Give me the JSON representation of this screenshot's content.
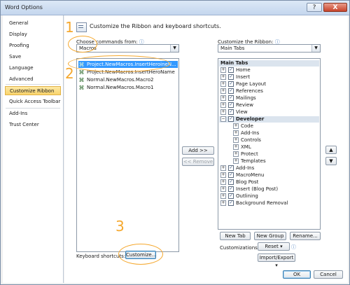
{
  "window": {
    "title": "Word Options",
    "help": "?",
    "close": "X"
  },
  "nav": [
    "General",
    "Display",
    "Proofing",
    "Save",
    "Language",
    "Advanced",
    "Customize Ribbon",
    "Quick Access Toolbar",
    "Add-Ins",
    "Trust Center"
  ],
  "header": "Customize the Ribbon and keyboard shortcuts.",
  "left": {
    "choose_label": "Choose commands from:",
    "choose_value": "Macros",
    "items": [
      "Project.NewMacros.InsertHeroineN...",
      "Project.NewMacros.InsertHeroName",
      "Normal.NewMacros.Macro2",
      "Normal.NewMacros.Macro1"
    ]
  },
  "right": {
    "customize_label": "Customize the Ribbon:",
    "customize_value": "Main Tabs",
    "tree": [
      {
        "label": "Main Tabs",
        "type": "header"
      },
      {
        "label": "Home",
        "type": "tab"
      },
      {
        "label": "Insert",
        "type": "tab"
      },
      {
        "label": "Page Layout",
        "type": "tab"
      },
      {
        "label": "References",
        "type": "tab"
      },
      {
        "label": "Mailings",
        "type": "tab"
      },
      {
        "label": "Review",
        "type": "tab"
      },
      {
        "label": "View",
        "type": "tab"
      },
      {
        "label": "Developer",
        "type": "tab-open"
      },
      {
        "label": "Code",
        "type": "group"
      },
      {
        "label": "Add-Ins",
        "type": "group"
      },
      {
        "label": "Controls",
        "type": "group"
      },
      {
        "label": "XML",
        "type": "group"
      },
      {
        "label": "Protect",
        "type": "group"
      },
      {
        "label": "Templates",
        "type": "group"
      },
      {
        "label": "Add-Ins",
        "type": "tab"
      },
      {
        "label": "MacroMenu",
        "type": "tab"
      },
      {
        "label": "Blog Post",
        "type": "tab"
      },
      {
        "label": "Insert (Blog Post)",
        "type": "tab"
      },
      {
        "label": "Outlining",
        "type": "tab"
      },
      {
        "label": "Background Removal",
        "type": "tab"
      }
    ]
  },
  "buttons": {
    "add": "Add >>",
    "remove": "<< Remove",
    "new_tab": "New Tab",
    "new_group": "New Group",
    "rename": "Rename...",
    "customizations_label": "Customizations:",
    "reset": "Reset ▾",
    "import_export": "Import/Export ▾",
    "keyboard_label": "Keyboard shortcuts:",
    "customize": "Customize...",
    "ok": "OK",
    "cancel": "Cancel",
    "move_up": "▲",
    "move_down": "▼"
  },
  "annotations": [
    "1",
    "2",
    "3"
  ]
}
